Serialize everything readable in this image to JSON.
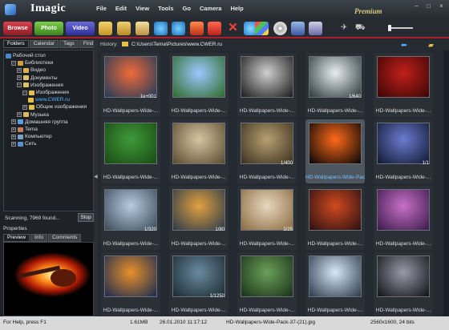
{
  "app": {
    "title": "Imagic",
    "edition": "Premium"
  },
  "menu": [
    "File",
    "Edit",
    "View",
    "Tools",
    "Go",
    "Camera",
    "Help"
  ],
  "modes": {
    "browse": "Browse",
    "photo": "Photo",
    "video": "Video"
  },
  "colors": {
    "accent_red": "#b01e2a",
    "selection_blue": "#4fb8ff",
    "browse": "#c0303c",
    "photo": "#5aa834",
    "video": "#4444b8"
  },
  "panel_tabs": [
    "Folders",
    "Calendar",
    "Tags",
    "Find"
  ],
  "tree": [
    {
      "label": "Рабочий стол",
      "icon": "desktop-icon",
      "level": 0,
      "exp": ""
    },
    {
      "label": "Библиотеки",
      "icon": "library-icon",
      "level": 1,
      "exp": "−"
    },
    {
      "label": "Видео",
      "icon": "video-folder-icon",
      "level": 2,
      "exp": "+"
    },
    {
      "label": "Документы",
      "icon": "documents-folder-icon",
      "level": 2,
      "exp": "+"
    },
    {
      "label": "Изображения",
      "icon": "pictures-folder-icon",
      "level": 2,
      "exp": "−"
    },
    {
      "label": "Изображения",
      "icon": "folder-icon",
      "level": 3,
      "exp": "−"
    },
    {
      "label": "www.CWER.ru",
      "icon": "folder-icon",
      "level": 4,
      "exp": "",
      "selected": true
    },
    {
      "label": "Общие изображения",
      "icon": "folder-icon",
      "level": 3,
      "exp": "+"
    },
    {
      "label": "Музыка",
      "icon": "music-folder-icon",
      "level": 2,
      "exp": "+"
    },
    {
      "label": "Домашняя группа",
      "icon": "homegroup-icon",
      "level": 1,
      "exp": "+"
    },
    {
      "label": "Tema",
      "icon": "user-icon",
      "level": 1,
      "exp": "+"
    },
    {
      "label": "Компьютер",
      "icon": "computer-icon",
      "level": 1,
      "exp": "+"
    },
    {
      "label": "Сеть",
      "icon": "network-icon",
      "level": 1,
      "exp": "+"
    }
  ],
  "scan": {
    "status": "Scanning, 7969 found...",
    "stop_label": "Stop"
  },
  "properties": {
    "title": "Properties",
    "tabs": [
      "Preview",
      "Info",
      "Comments"
    ]
  },
  "history": {
    "label": "History:",
    "path": "C:\\Users\\Tema\\Pictures\\www.CWER.ru"
  },
  "thumbnails": [
    {
      "caption": "HD-Wallpapers-Wide-...",
      "meta": "1e+001",
      "c1": "#f06a3a",
      "c2": "#203a5a"
    },
    {
      "caption": "HD-Wallpapers-Wide-...",
      "meta": "",
      "c1": "#9cc8ff",
      "c2": "#2e6b2a"
    },
    {
      "caption": "HD-Wallpapers-Wide-...",
      "meta": "",
      "c1": "#cfcfcf",
      "c2": "#1a1a1a"
    },
    {
      "caption": "HD-Wallpapers-Wide-...",
      "meta": "1/640",
      "c1": "#e8eef0",
      "c2": "#2a3a3a"
    },
    {
      "caption": "HD-Wallpapers-Wide-...",
      "meta": "",
      "c1": "#c0201a",
      "c2": "#3a0606"
    },
    {
      "caption": "HD-Wallpapers-Wide-...",
      "meta": "",
      "c1": "#3f9a3a",
      "c2": "#1a4a14"
    },
    {
      "caption": "HD-Wallpapers-Wide-...",
      "meta": "",
      "c1": "#d8c4a0",
      "c2": "#5a4a30"
    },
    {
      "caption": "HD-Wallpapers-Wide-...",
      "meta": "1/400",
      "c1": "#b8a070",
      "c2": "#3a3020"
    },
    {
      "caption": "HD-Wallpapers-Wide-Pack",
      "meta": "",
      "c1": "#ff6a1a",
      "c2": "#050505",
      "selected": true
    },
    {
      "caption": "HD-Wallpapers-Wide-...",
      "meta": "1/1",
      "c1": "#6a7cd0",
      "c2": "#101830"
    },
    {
      "caption": "HD-Wallpapers-Wide-...",
      "meta": "1/320",
      "c1": "#b8cce0",
      "c2": "#3a4a5a"
    },
    {
      "caption": "HD-Wallpapers-Wide-...",
      "meta": "1/80",
      "c1": "#e0a040",
      "c2": "#2a3a4a"
    },
    {
      "caption": "HD-Wallpapers-Wide-...",
      "meta": "1/25",
      "c1": "#e8d8c0",
      "c2": "#8a6a40"
    },
    {
      "caption": "HD-Wallpapers-Wide-...",
      "meta": "",
      "c1": "#d04a20",
      "c2": "#2a1010"
    },
    {
      "caption": "HD-Wallpapers-Wide-...",
      "meta": "",
      "c1": "#c870c8",
      "c2": "#3a1a4a"
    },
    {
      "caption": "HD-Wallpapers-Wide-...",
      "meta": "",
      "c1": "#e8902a",
      "c2": "#1a2a50"
    },
    {
      "caption": "HD-Wallpapers-Wide-...",
      "meta": "1/1250",
      "c1": "#6a8aa0",
      "c2": "#1a2a30"
    },
    {
      "caption": "HD-Wallpapers-Wide-...",
      "meta": "",
      "c1": "#6aa05a",
      "c2": "#1a3018"
    },
    {
      "caption": "HD-Wallpapers-Wide-...",
      "meta": "",
      "c1": "#d8e8f8",
      "c2": "#2a3a4a"
    },
    {
      "caption": "HD-Wallpapers-Wide-...",
      "meta": "",
      "c1": "#9a9aa8",
      "c2": "#101018"
    }
  ],
  "status": {
    "help": "For Help, press F1",
    "size": "1.61MB",
    "date": "26.01.2010 11:17:12",
    "file": "HD-Wallpapers-Wide-Pack-37-(21).jpg",
    "dims": "2560x1600, 24 bits"
  },
  "toolbar_icons": [
    "open-folder-icon",
    "browse-folder-icon",
    "copy-icon",
    "rotate-left-icon",
    "rotate-right-icon",
    "edit-icon",
    "delete-icon",
    "refresh-icon",
    "slideshow-icon",
    "cd-icon",
    "print-icon",
    "email-icon",
    "tag-icon",
    "cart-icon"
  ]
}
